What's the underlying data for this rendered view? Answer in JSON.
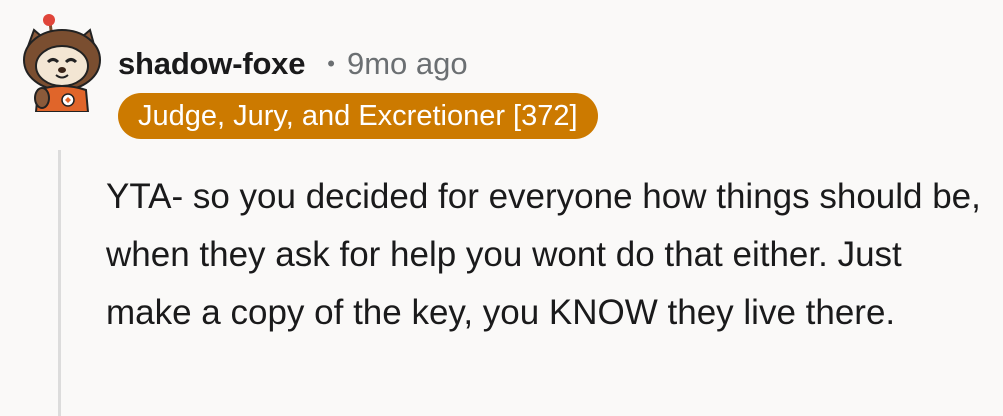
{
  "comment": {
    "author": "shadow-foxe",
    "separator": "•",
    "timestamp": "9mo ago",
    "flair": "Judge, Jury, and Excretioner [372]",
    "body": "YTA- so you decided for everyone how things should be, when they ask for help you wont do that either. Just make a copy of the key, you KNOW they live there."
  },
  "colors": {
    "background": "#faf9f8",
    "flair_bg": "#cc7a00",
    "flair_text": "#ffffff",
    "meta_text": "#6b6f72",
    "thread_line": "#dcdcdc"
  },
  "icons": {
    "avatar": "snoo-fox-avatar-icon"
  }
}
